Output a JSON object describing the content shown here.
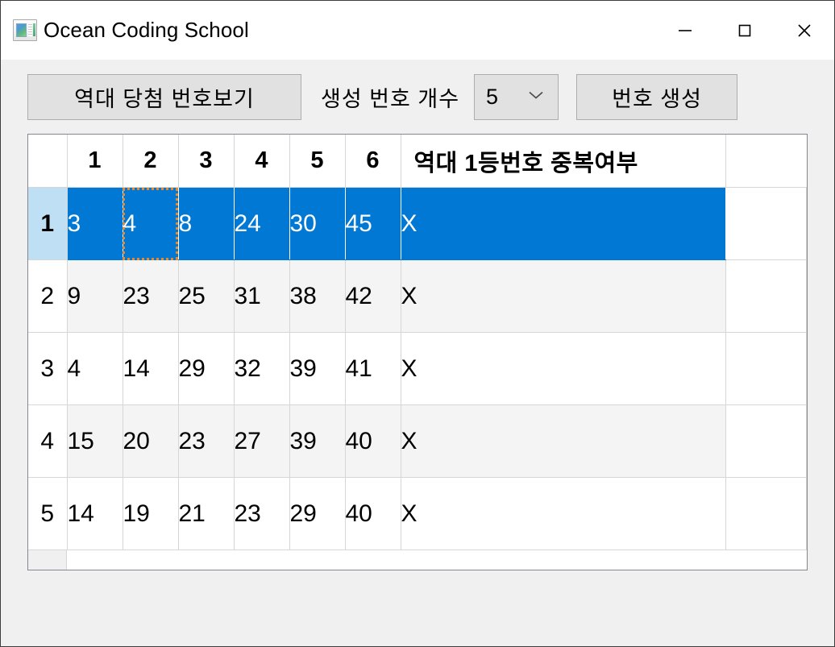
{
  "window": {
    "title": "Ocean Coding School",
    "icon": "app-window-icon",
    "controls": {
      "minimize": "minimize-icon",
      "maximize": "maximize-icon",
      "close": "close-icon"
    }
  },
  "toolbar": {
    "history_button": "역대 당첨 번호보기",
    "count_label": "생성 번호 개수",
    "count_value": "5",
    "count_caret": "chevron-down-icon",
    "generate_button": "번호 생성"
  },
  "grid": {
    "headers": [
      "",
      "1",
      "2",
      "3",
      "4",
      "5",
      "6",
      "역대 1등번호 중복여부"
    ],
    "rows": [
      {
        "index": "1",
        "numbers": [
          "3",
          "4",
          "8",
          "24",
          "30",
          "45"
        ],
        "dup": "X",
        "selected": true,
        "focused_col": 1
      },
      {
        "index": "2",
        "numbers": [
          "9",
          "23",
          "25",
          "31",
          "38",
          "42"
        ],
        "dup": "X",
        "selected": false,
        "focused_col": -1
      },
      {
        "index": "3",
        "numbers": [
          "4",
          "14",
          "29",
          "32",
          "39",
          "41"
        ],
        "dup": "X",
        "selected": false,
        "focused_col": -1
      },
      {
        "index": "4",
        "numbers": [
          "15",
          "20",
          "23",
          "27",
          "39",
          "40"
        ],
        "dup": "X",
        "selected": false,
        "focused_col": -1
      },
      {
        "index": "5",
        "numbers": [
          "14",
          "19",
          "21",
          "23",
          "29",
          "40"
        ],
        "dup": "X",
        "selected": false,
        "focused_col": -1
      }
    ]
  },
  "colors": {
    "selection_blue": "#0078d4",
    "row_header_selected": "#bfdff5",
    "focus_orange": "#e8892b",
    "alt_row": "#f4f4f4",
    "window_bg": "#f0f0f0",
    "button_face": "#e1e1e1"
  }
}
